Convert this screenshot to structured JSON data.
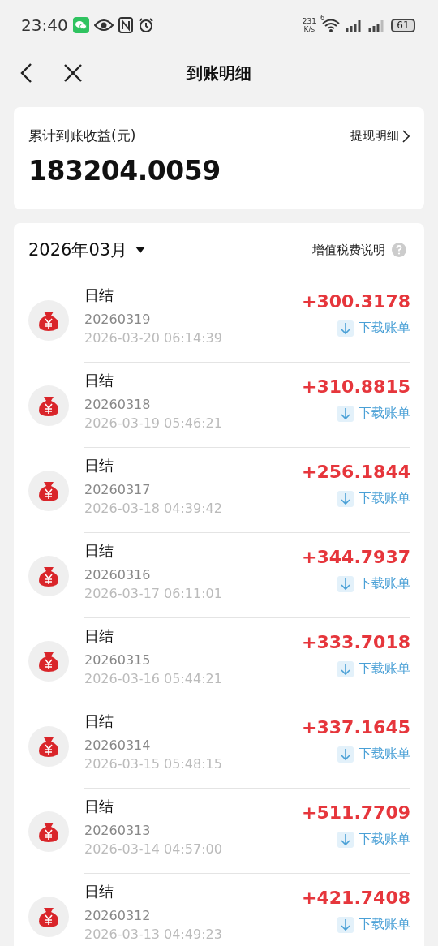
{
  "status_bar": {
    "time": "23:40",
    "speed_value": "231",
    "speed_unit": "K/s",
    "wifi_badge": "6",
    "battery": "61"
  },
  "header": {
    "title": "到账明细"
  },
  "summary": {
    "label": "累计到账收益(元)",
    "link": "提现明细",
    "amount": "183204.0059"
  },
  "month_bar": {
    "month": "2026年03月",
    "tax_link": "增值税费说明"
  },
  "records": [
    {
      "title": "日结",
      "batch": "20260319",
      "time": "2026-03-20 06:14:39",
      "amount": "+300.3178",
      "download": "下载账单"
    },
    {
      "title": "日结",
      "batch": "20260318",
      "time": "2026-03-19 05:46:21",
      "amount": "+310.8815",
      "download": "下载账单"
    },
    {
      "title": "日结",
      "batch": "20260317",
      "time": "2026-03-18 04:39:42",
      "amount": "+256.1844",
      "download": "下载账单"
    },
    {
      "title": "日结",
      "batch": "20260316",
      "time": "2026-03-17 06:11:01",
      "amount": "+344.7937",
      "download": "下载账单"
    },
    {
      "title": "日结",
      "batch": "20260315",
      "time": "2026-03-16 05:44:21",
      "amount": "+333.7018",
      "download": "下载账单"
    },
    {
      "title": "日结",
      "batch": "20260314",
      "time": "2026-03-15 05:48:15",
      "amount": "+337.1645",
      "download": "下载账单"
    },
    {
      "title": "日结",
      "batch": "20260313",
      "time": "2026-03-14 04:57:00",
      "amount": "+511.7709",
      "download": "下载账单"
    },
    {
      "title": "日结",
      "batch": "20260312",
      "time": "2026-03-13 04:49:23",
      "amount": "+421.7408",
      "download": "下载账单"
    }
  ]
}
